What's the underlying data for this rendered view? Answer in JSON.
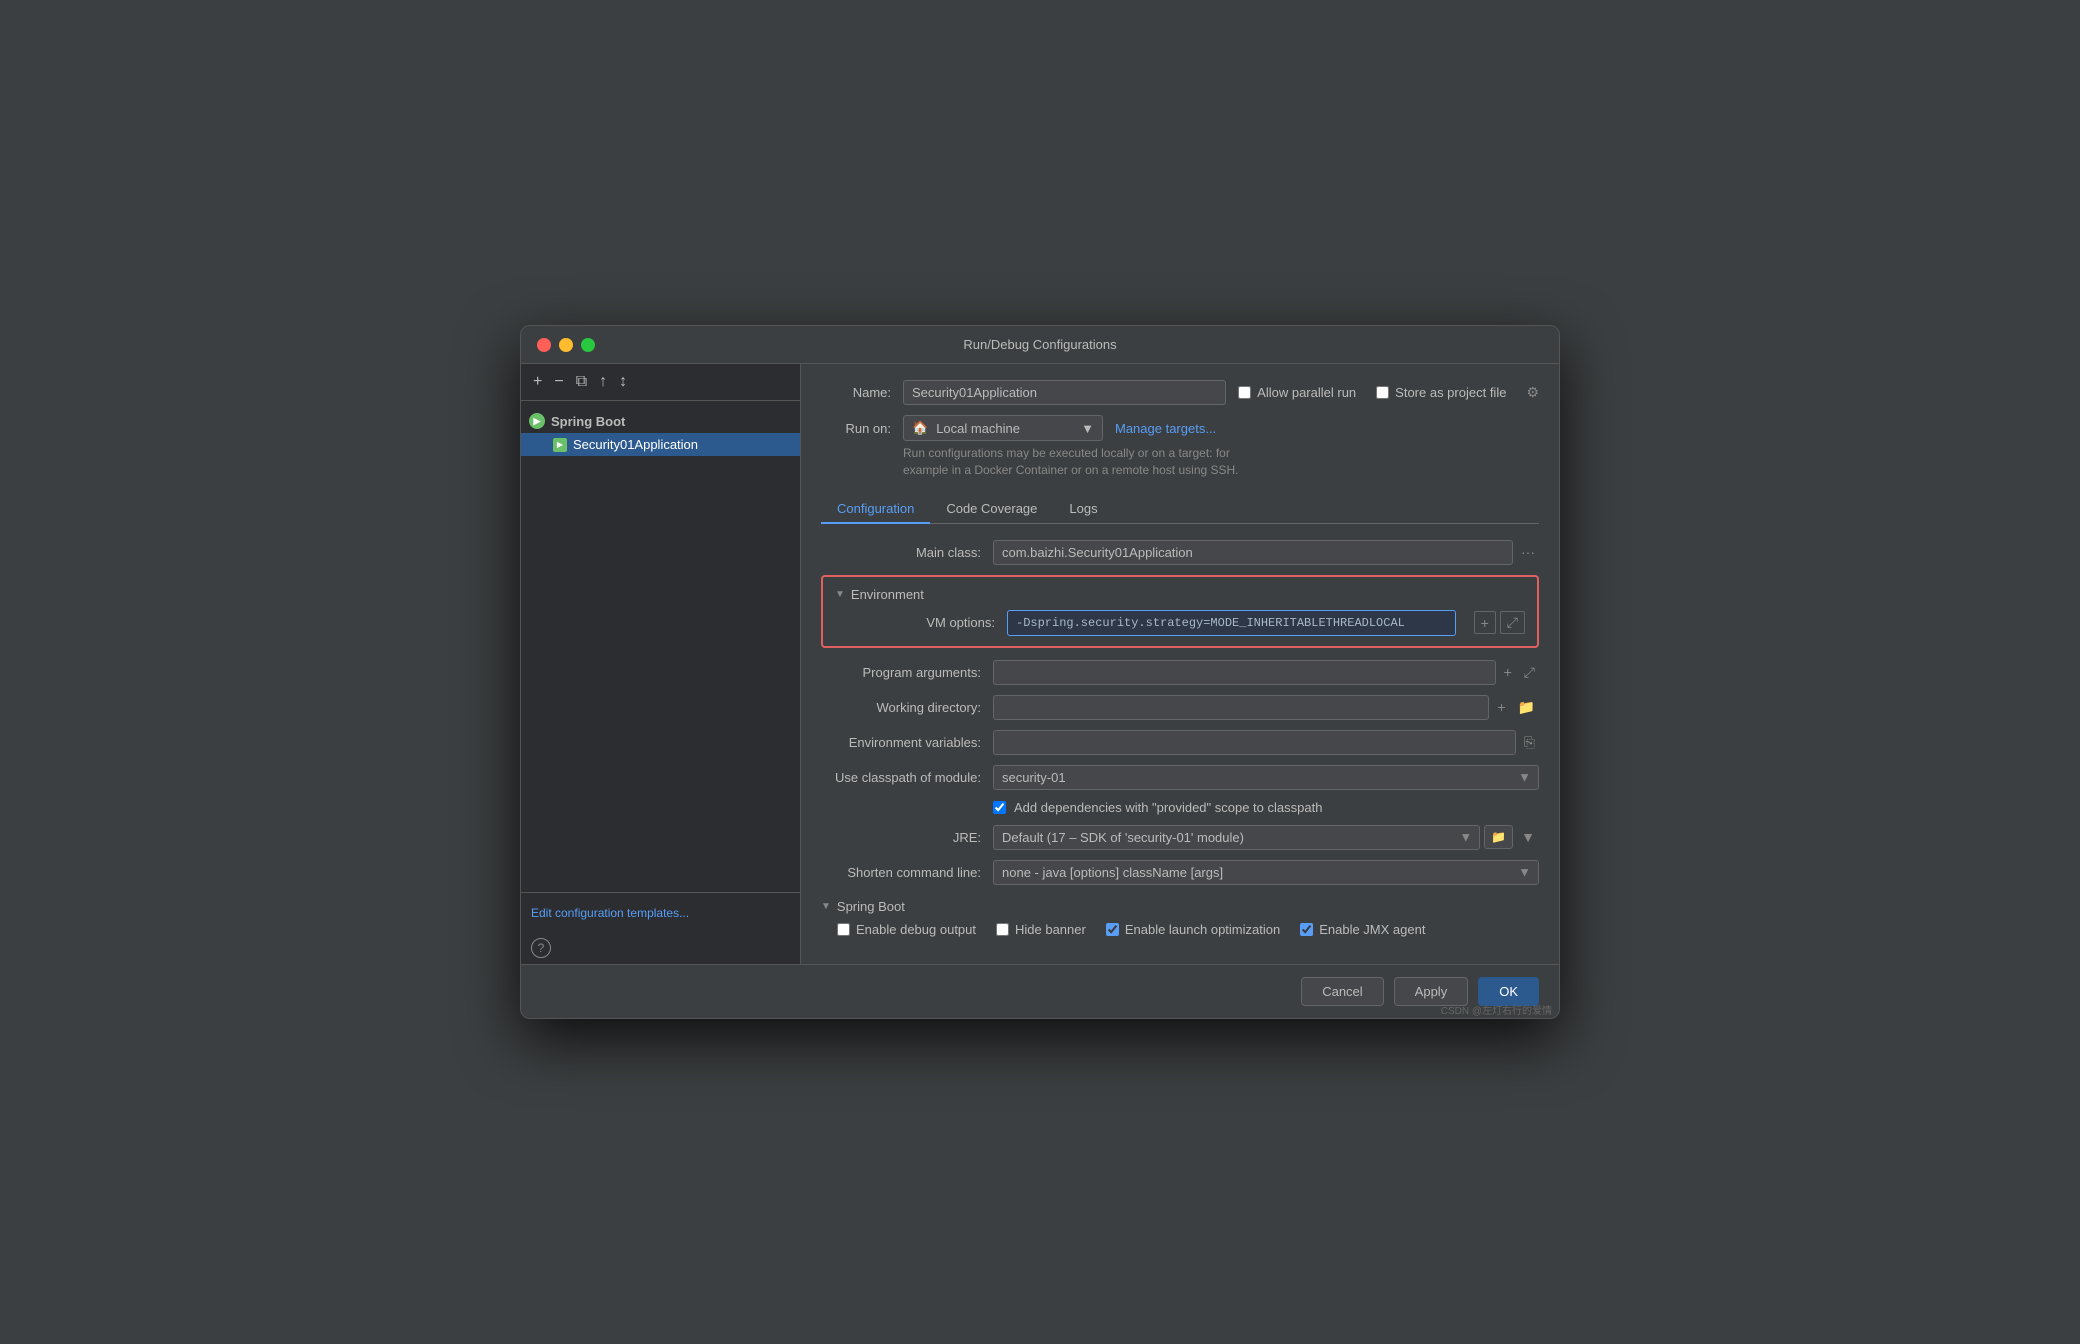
{
  "window": {
    "title": "Run/Debug Configurations"
  },
  "sidebar": {
    "group_name": "Spring Boot",
    "item_name": "Security01Application",
    "edit_templates_label": "Edit configuration templates...",
    "question_label": "?"
  },
  "toolbar": {
    "add": "+",
    "remove": "−",
    "copy": "⧉",
    "move_up": "⬆",
    "sort": "↕"
  },
  "form": {
    "name_label": "Name:",
    "name_value": "Security01Application",
    "allow_parallel_label": "Allow parallel run",
    "store_as_project_label": "Store as project file",
    "run_on_label": "Run on:",
    "local_machine_value": "Local machine",
    "manage_targets_label": "Manage targets...",
    "run_on_hint": "Run configurations may be executed locally or on a target: for\nexample in a Docker Container or on a remote host using SSH.",
    "tabs": [
      {
        "label": "Configuration",
        "active": true
      },
      {
        "label": "Code Coverage",
        "active": false
      },
      {
        "label": "Logs",
        "active": false
      }
    ],
    "main_class_label": "Main class:",
    "main_class_value": "com.baizhi.Security01Application",
    "environment_label": "Environment",
    "vm_options_label": "VM options:",
    "vm_options_value": "-Dspring.security.strategy=MODE_INHERITABLETHREADLOCAL",
    "program_args_label": "Program arguments:",
    "working_dir_label": "Working directory:",
    "env_vars_label": "Environment variables:",
    "classpath_label": "Use classpath of module:",
    "classpath_value": "security-01",
    "add_dependencies_label": "Add dependencies with \"provided\" scope to classpath",
    "jre_label": "JRE:",
    "jre_value": "Default (17 – SDK of 'security-01' module)",
    "shorten_cmd_label": "Shorten command line:",
    "shorten_cmd_value": "none - java [options] className [args]",
    "spring_boot_label": "Spring Boot",
    "enable_debug_label": "Enable debug output",
    "hide_banner_label": "Hide banner",
    "enable_launch_label": "Enable launch optimization",
    "enable_jmx_label": "Enable JMX agent"
  },
  "footer": {
    "cancel_label": "Cancel",
    "apply_label": "Apply",
    "ok_label": "OK"
  },
  "watermark": "CSDN @左灯右行的爱情"
}
